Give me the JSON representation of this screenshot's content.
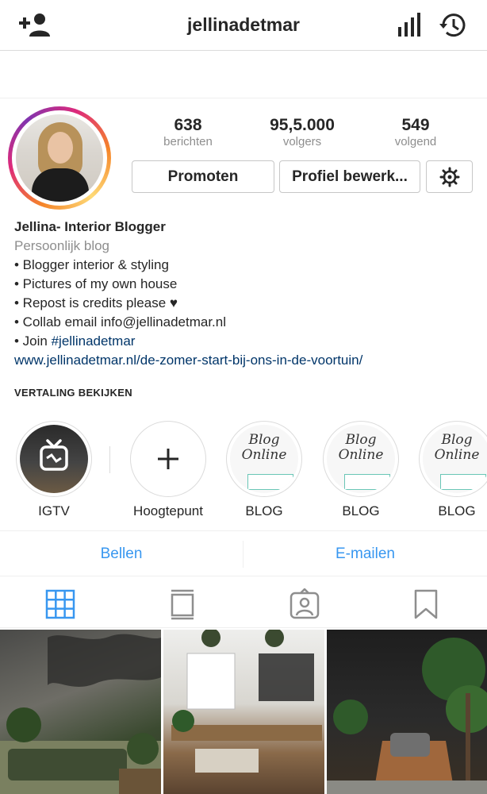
{
  "header": {
    "username": "jellinadetmar",
    "icons": [
      "add-user-icon",
      "insights-icon",
      "archive-icon"
    ]
  },
  "profile": {
    "stats": [
      {
        "value": "638",
        "label": "berichten"
      },
      {
        "value": "95,5.000",
        "label": "volgers"
      },
      {
        "value": "549",
        "label": "volgend"
      }
    ],
    "promote_label": "Promoten",
    "edit_label": "Profiel bewerk...",
    "settings_icon": "gear-icon"
  },
  "bio": {
    "name": "Jellina- Interior Blogger",
    "category": "Persoonlijk blog",
    "lines": [
      "• Blogger interior & styling",
      "• Pictures of my own house",
      "• Repost is credits please ♥",
      "• Collab email info@jellinadetmar.nl"
    ],
    "join_prefix": "• Join ",
    "hashtag": "#jellinadetmar",
    "link": "www.jellinadetmar.nl/de-zomer-start-bij-ons-in-de-voortuin/",
    "translate": "VERTALING BEKIJKEN"
  },
  "highlights": [
    {
      "label": "IGTV"
    },
    {
      "label": "Hoogtepunt"
    },
    {
      "label": "BLOG",
      "script": "Blog Online"
    },
    {
      "label": "BLOG",
      "script": "Blog Online"
    },
    {
      "label": "BLOG",
      "script": "Blog Online"
    }
  ],
  "contact": {
    "call": "Bellen",
    "email": "E-mailen"
  },
  "tabs": [
    {
      "icon": "grid-icon",
      "active": true
    },
    {
      "icon": "feed-icon",
      "active": false
    },
    {
      "icon": "tagged-icon",
      "active": false
    },
    {
      "icon": "saved-icon",
      "active": false
    }
  ],
  "colors": {
    "accent": "#3897f0",
    "link": "#003569",
    "muted": "#8e8e8e",
    "text": "#262626",
    "border": "#dbdbdb"
  }
}
